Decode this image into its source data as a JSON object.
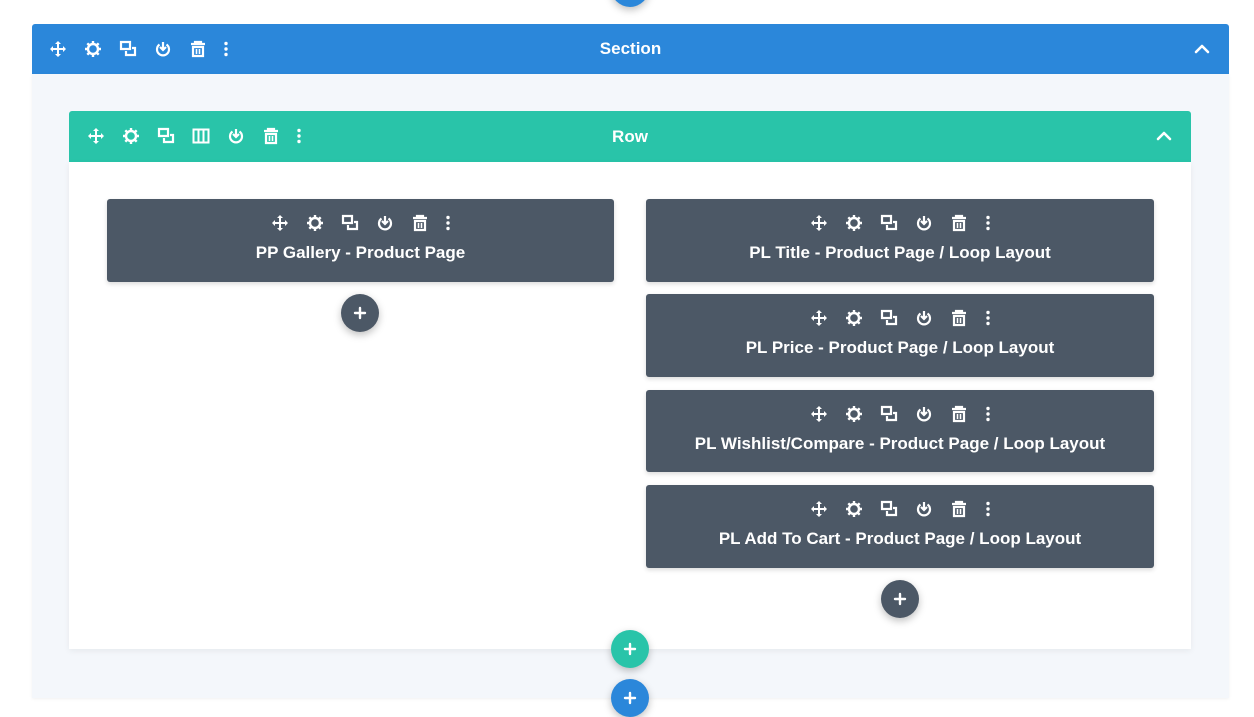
{
  "colors": {
    "section": "#2b87da",
    "row": "#29c4a9",
    "module": "#4c5866",
    "add_module": "#4c5866",
    "section_body": "#f4f7fb"
  },
  "section": {
    "title": "Section",
    "tools": [
      "move-icon",
      "gear-icon",
      "duplicate-icon",
      "save-icon",
      "trash-icon",
      "more-vertical-icon"
    ],
    "collapse_icon": "chevron-up-icon"
  },
  "row": {
    "title": "Row",
    "tools": [
      "move-icon",
      "gear-icon",
      "duplicate-icon",
      "columns-icon",
      "save-icon",
      "trash-icon",
      "more-vertical-icon"
    ],
    "collapse_icon": "chevron-up-icon"
  },
  "columns": [
    {
      "modules": [
        {
          "title": "PP Gallery - Product Page"
        }
      ]
    },
    {
      "modules": [
        {
          "title": "PL Title - Product Page / Loop Layout"
        },
        {
          "title": "PL Price - Product Page / Loop Layout"
        },
        {
          "title": "PL Wishlist/Compare - Product Page / Loop Layout"
        },
        {
          "title": "PL Add To Cart - Product Page / Loop Layout"
        }
      ]
    }
  ],
  "module_tools": [
    "move-icon",
    "gear-icon",
    "duplicate-icon",
    "save-icon",
    "trash-icon",
    "more-vertical-icon"
  ],
  "add_button_icon": "plus-icon"
}
